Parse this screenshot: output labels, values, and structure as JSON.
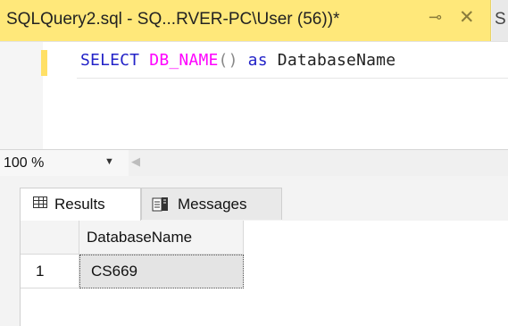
{
  "tab": {
    "title": "SQLQuery2.sql - SQ...RVER-PC\\User (56))*",
    "pin_glyph": "⊸",
    "close_glyph": "✕",
    "next_tab_fragment": "S"
  },
  "editor": {
    "sql": {
      "kw1": "SELECT",
      "fn": "DB_NAME",
      "parens": "()",
      "kw2": "as",
      "alias": "DatabaseName"
    }
  },
  "zoom": {
    "value": "100 %",
    "arrow": "▼",
    "scroll_left": "◀"
  },
  "result_tabs": {
    "results_label": "Results",
    "messages_label": "Messages"
  },
  "grid": {
    "columns": [
      "DatabaseName"
    ],
    "rows": [
      {
        "row_number": "1",
        "values": [
          "CS669"
        ]
      }
    ]
  },
  "colors": {
    "active_tab": "#ffe87a",
    "keyword": "#2323c8",
    "function": "#ff00ff"
  }
}
